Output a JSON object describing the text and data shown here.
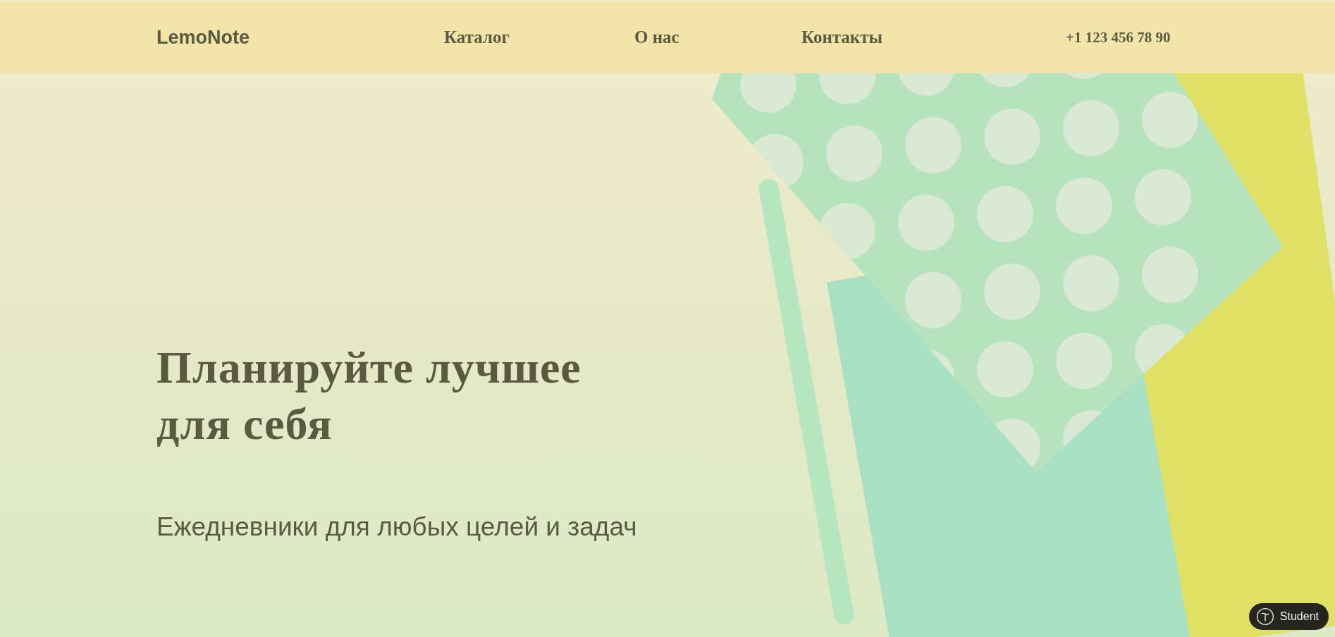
{
  "header": {
    "logo": "LemoNote",
    "nav": [
      {
        "label": "Каталог"
      },
      {
        "label": "О нас"
      },
      {
        "label": "Контакты"
      }
    ],
    "phone": "+1 123 456 78 90"
  },
  "hero": {
    "title_lines": [
      "Планируйте лучшее",
      "для себя"
    ],
    "subtitle": "Ежедневники для любых целей и задач"
  },
  "badge": {
    "label": "Student"
  }
}
